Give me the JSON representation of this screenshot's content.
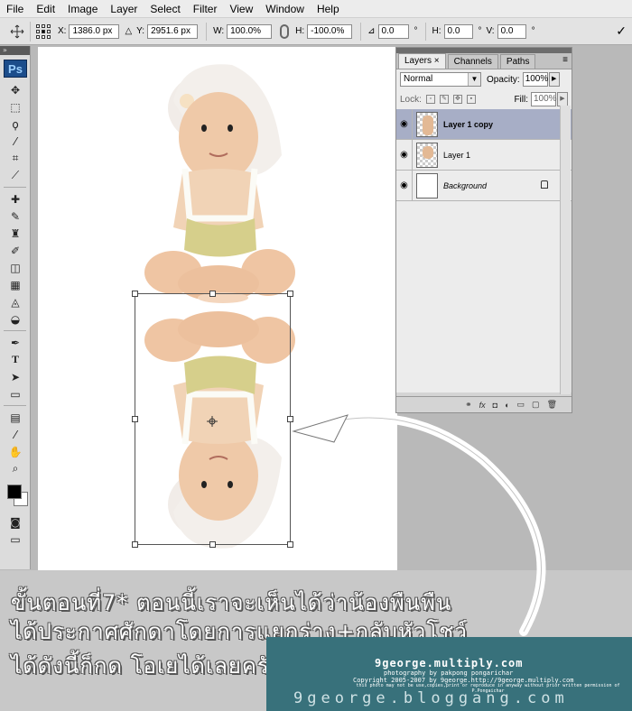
{
  "menu": [
    "File",
    "Edit",
    "Image",
    "Layer",
    "Select",
    "Filter",
    "View",
    "Window",
    "Help"
  ],
  "options": {
    "x_label": "X:",
    "x_value": "1386.0 px",
    "y_label": "Y:",
    "y_value": "2951.6 px",
    "w_label": "W:",
    "w_value": "100.0%",
    "h_label": "H:",
    "h_value": "-100.0%",
    "angle_value": "0.0",
    "deg": "°",
    "hskew_label": "H:",
    "hskew_value": "0.0",
    "vskew_label": "V:",
    "vskew_value": "0.0"
  },
  "toolbox": {
    "logo": "Ps"
  },
  "layers_panel": {
    "tabs": [
      "Layers",
      "Channels",
      "Paths"
    ],
    "tab_close": "×",
    "blend_mode": "Normal",
    "opacity_label": "Opacity:",
    "opacity_value": "100%",
    "lock_label": "Lock:",
    "fill_label": "Fill:",
    "fill_value": "100%",
    "layers": [
      {
        "name": "Layer 1 copy",
        "visible": true,
        "selected": true
      },
      {
        "name": "Layer 1",
        "visible": true,
        "selected": false
      },
      {
        "name": "Background",
        "visible": true,
        "selected": false,
        "locked": true
      }
    ]
  },
  "caption": {
    "line1": "ขั้นตอนที่7* ตอนนี้เราจะเห็นได้ว่าน้องพืนพืน",
    "line2": "ได้ประกาศศักดาโดยการแยกร่าง+กลับหัวโชว์",
    "line3": "ได้ดังนี้ก็กด โอเยได้เลยครับ"
  },
  "watermark": {
    "site": "9george.multiply.com",
    "credit": "photography by pakpong pongarichar",
    "copyright": "Copyright 2005-2007 by 9george.http://9george.multiply.com",
    "notice": "this photo may not be use,copies,print or reproduce in anyway without prior written permission of P.Pongaichar",
    "blog": "9george.bloggang.com"
  },
  "colors": {
    "selected_layer": "#a7aec6",
    "banner": "#38717b",
    "ps_logo": "#1c4d8b"
  }
}
